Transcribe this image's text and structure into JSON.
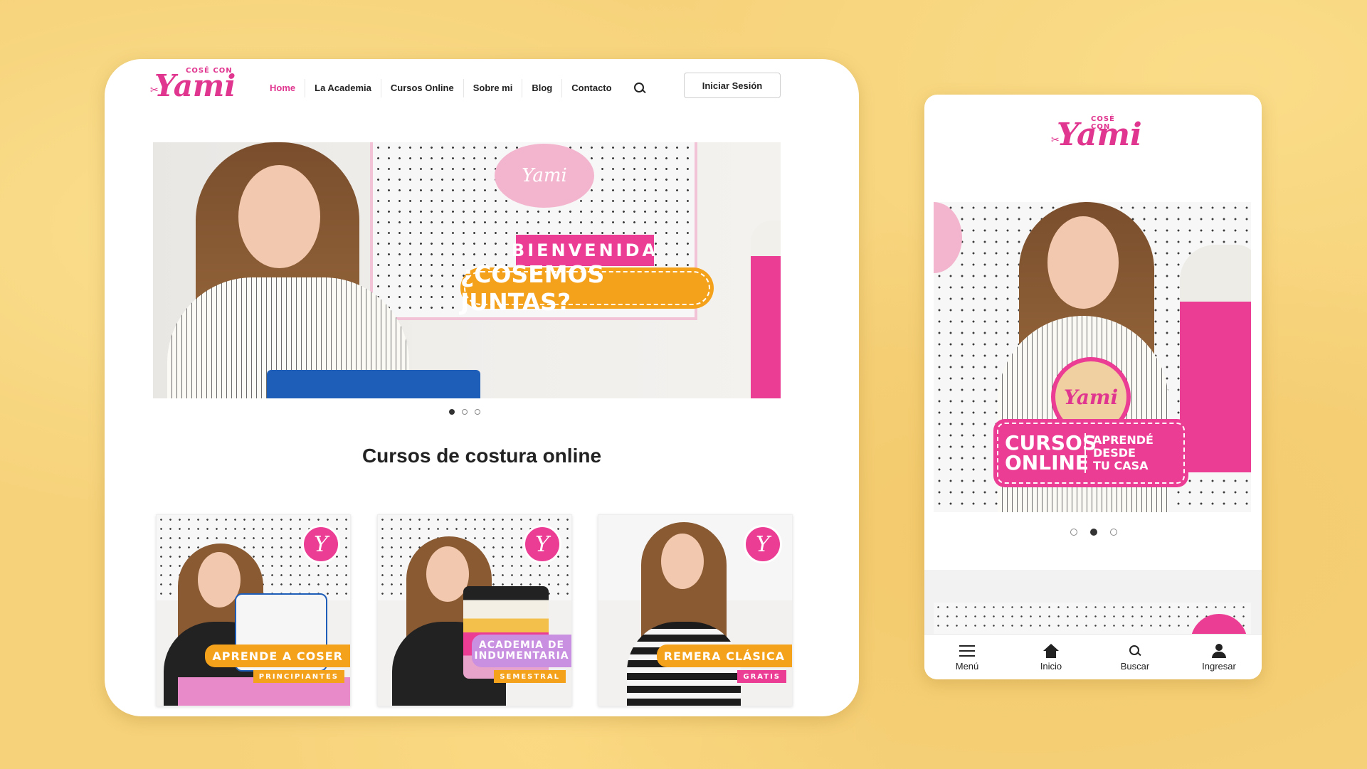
{
  "brand": {
    "logo_small": "COSÉ CON",
    "logo_name": "Yami",
    "accent": "#e0368f"
  },
  "desktop": {
    "nav": {
      "items": [
        "Home",
        "La Academia",
        "Cursos Online",
        "Sobre mi",
        "Blog",
        "Contacto"
      ],
      "active": "Home",
      "login": "Iniciar Sesión"
    },
    "hero": {
      "plaque": "Yami",
      "badge_top": "BIENVENIDA",
      "badge_main": "¿COSEMOS JUNTAS?",
      "slides": 3,
      "active_slide": 1
    },
    "section_title": "Cursos de costura online",
    "courses": [
      {
        "title": "APRENDE A COSER",
        "subtitle": "PRINCIPIANTES",
        "badge": "Y",
        "label_color": "#f4a21c",
        "sub_color": "#f4a21c"
      },
      {
        "title": "ACADEMIA DE INDUMENTARIA",
        "subtitle": "SEMESTRAL",
        "badge": "Y",
        "label_color": "#c98fe0",
        "sub_color": "#f4a21c"
      },
      {
        "title": "REMERA CLÁSICA",
        "subtitle": "GRATIS",
        "badge": "Y",
        "label_color": "#f4a21c",
        "sub_color": "#ec3d95"
      }
    ]
  },
  "mobile": {
    "hero": {
      "badge_circle": "Yami",
      "cursos": "CURSOS",
      "online": "ONLINE",
      "aprende": "APRENDÉ DESDE",
      "tu_casa": "TU CASA",
      "slides": 3,
      "active_slide": 2
    },
    "tabbar": [
      {
        "label": "Menú",
        "icon": "menu-icon"
      },
      {
        "label": "Inicio",
        "icon": "home-icon"
      },
      {
        "label": "Buscar",
        "icon": "search-icon"
      },
      {
        "label": "Ingresar",
        "icon": "user-icon"
      }
    ]
  }
}
